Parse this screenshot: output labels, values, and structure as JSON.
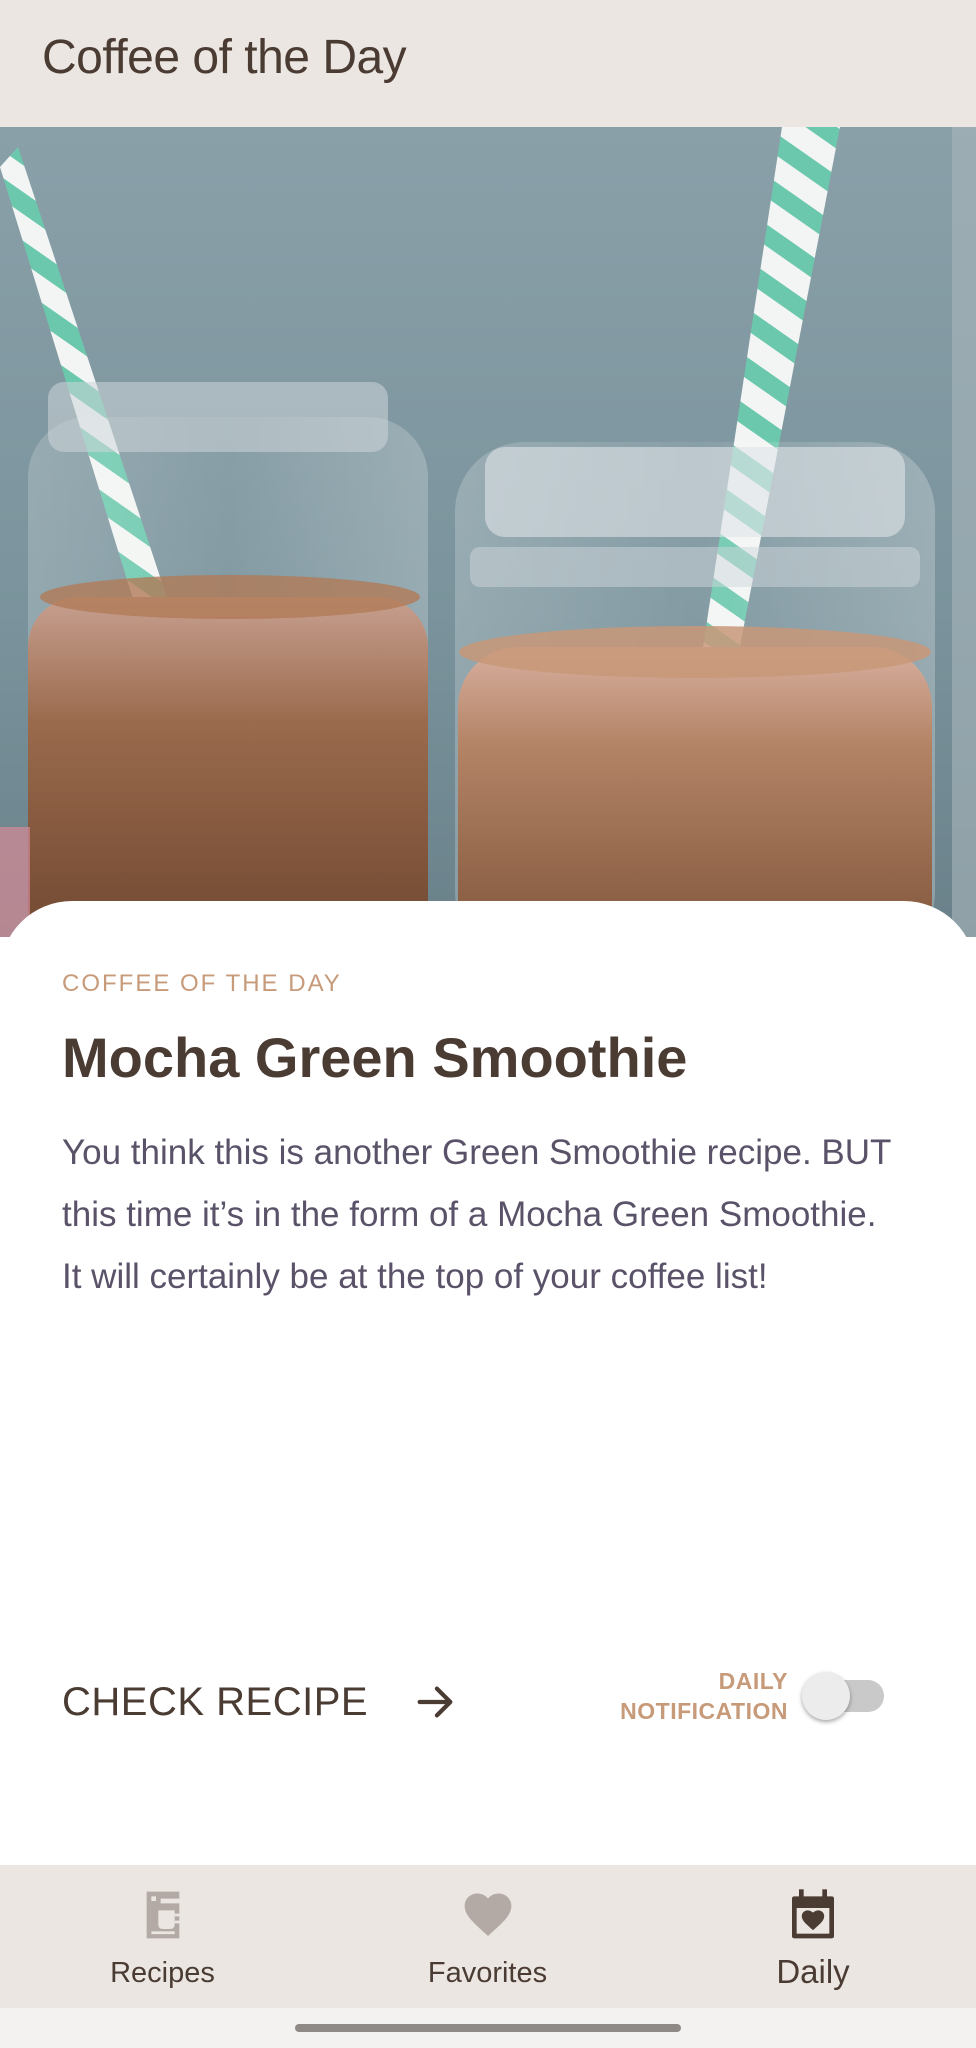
{
  "app_bar": {
    "title": "Coffee of the Day"
  },
  "hero": {
    "image": "mocha-smoothie-jars-photo"
  },
  "card": {
    "overline": "COFFEE OF THE DAY",
    "title": "Mocha Green Smoothie",
    "description": "You think this is another Green Smoothie recipe. BUT this time it’s in the form of a Mocha Green Smoothie. It will certainly be at the top of your coffee list!",
    "check_recipe_label": "CHECK RECIPE",
    "daily_notification_line1": "DAILY",
    "daily_notification_line2": "NOTIFICATION",
    "daily_notification_on": false
  },
  "bottom_nav": {
    "items": [
      {
        "label": "Recipes",
        "icon": "coffee-maker-icon",
        "active": false
      },
      {
        "label": "Favorites",
        "icon": "heart-icon",
        "active": false
      },
      {
        "label": "Daily",
        "icon": "calendar-heart-icon",
        "active": true
      }
    ]
  },
  "colors": {
    "bar_background": "#ebe6e1",
    "primary_text": "#4a3b33",
    "accent": "#c79a7a",
    "body_text": "#5a5268",
    "inactive_icon": "#b3aaa6"
  }
}
